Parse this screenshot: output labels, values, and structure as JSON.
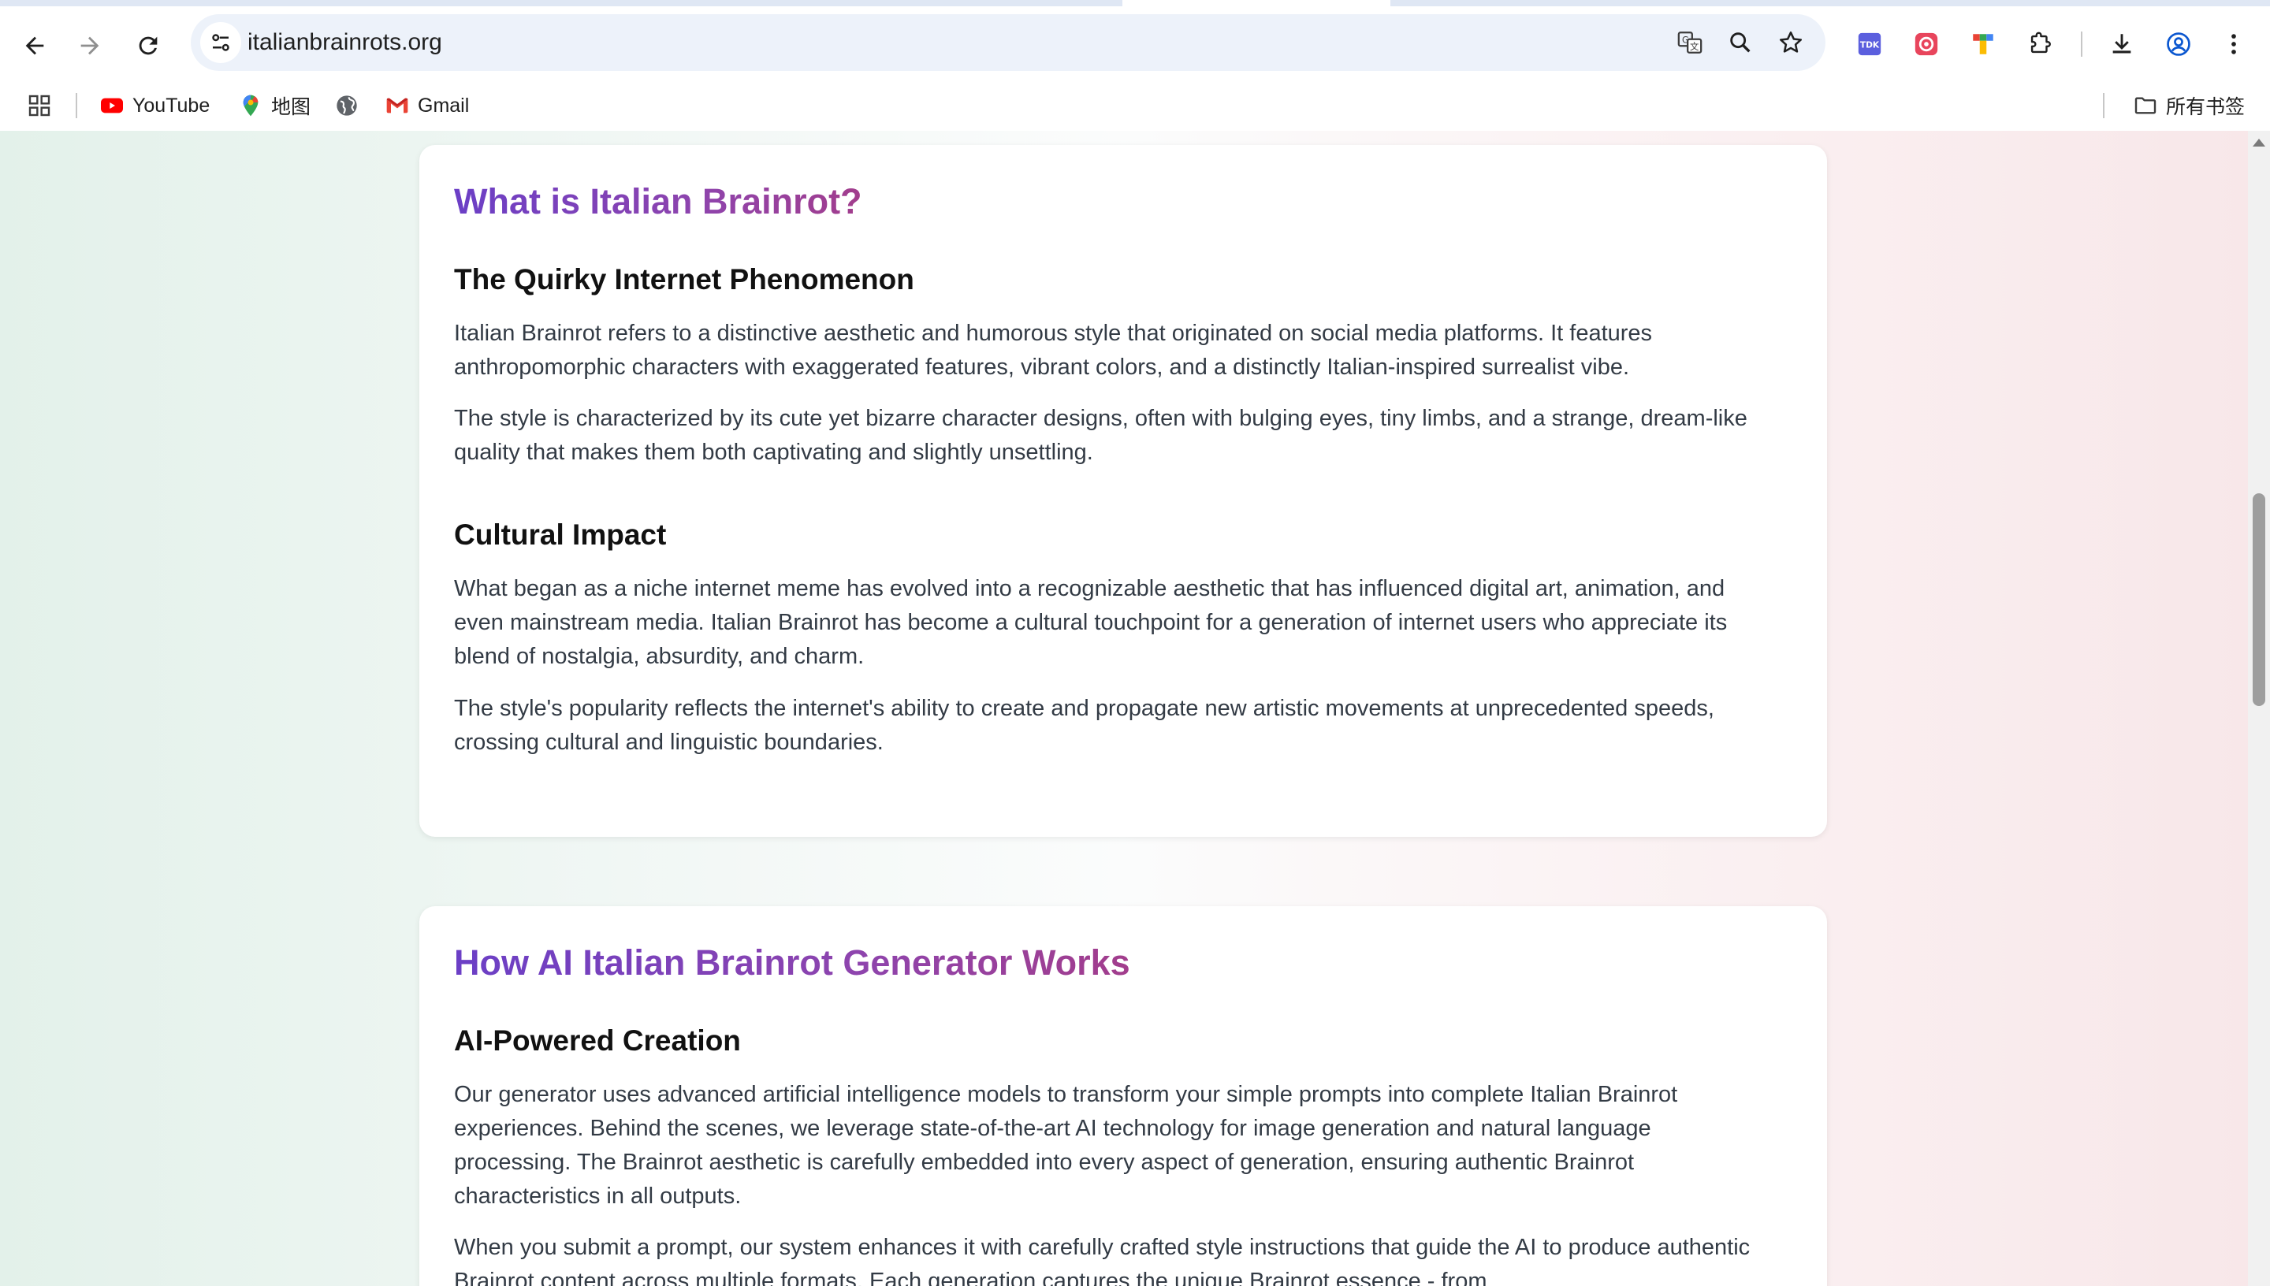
{
  "browser": {
    "url": "italianbrainrots.org",
    "bookmarks": [
      {
        "label": "YouTube",
        "icon": "youtube-icon"
      },
      {
        "label": "地图",
        "icon": "maps-pin-icon"
      },
      {
        "label": "",
        "icon": "globe-icon"
      },
      {
        "label": "Gmail",
        "icon": "gmail-icon"
      }
    ],
    "all_bookmarks_label": "所有书签",
    "extension_tdk_label": "TDK"
  },
  "sections": [
    {
      "title": "What is Italian Brainrot?",
      "blocks": [
        {
          "heading": "The Quirky Internet Phenomenon",
          "paragraphs": [
            "Italian Brainrot refers to a distinctive aesthetic and humorous style that originated on social media platforms. It features anthropomorphic characters with exaggerated features, vibrant colors, and a distinctly Italian-inspired surrealist vibe.",
            "The style is characterized by its cute yet bizarre character designs, often with bulging eyes, tiny limbs, and a strange, dream-like quality that makes them both captivating and slightly unsettling."
          ]
        },
        {
          "heading": "Cultural Impact",
          "paragraphs": [
            "What began as a niche internet meme has evolved into a recognizable aesthetic that has influenced digital art, animation, and even mainstream media. Italian Brainrot has become a cultural touchpoint for a generation of internet users who appreciate its blend of nostalgia, absurdity, and charm.",
            "The style's popularity reflects the internet's ability to create and propagate new artistic movements at unprecedented speeds, crossing cultural and linguistic boundaries."
          ]
        }
      ]
    },
    {
      "title": "How AI Italian Brainrot Generator Works",
      "blocks": [
        {
          "heading": "AI-Powered Creation",
          "paragraphs": [
            "Our generator uses advanced artificial intelligence models to transform your simple prompts into complete Italian Brainrot experiences. Behind the scenes, we leverage state-of-the-art AI technology for image generation and natural language processing. The Brainrot aesthetic is carefully embedded into every aspect of generation, ensuring authentic Brainrot characteristics in all outputs.",
            "When you submit a prompt, our system enhances it with carefully crafted style instructions that guide the AI to produce authentic Brainrot content across multiple formats. Each generation captures the unique Brainrot essence - from"
          ]
        }
      ]
    }
  ]
}
